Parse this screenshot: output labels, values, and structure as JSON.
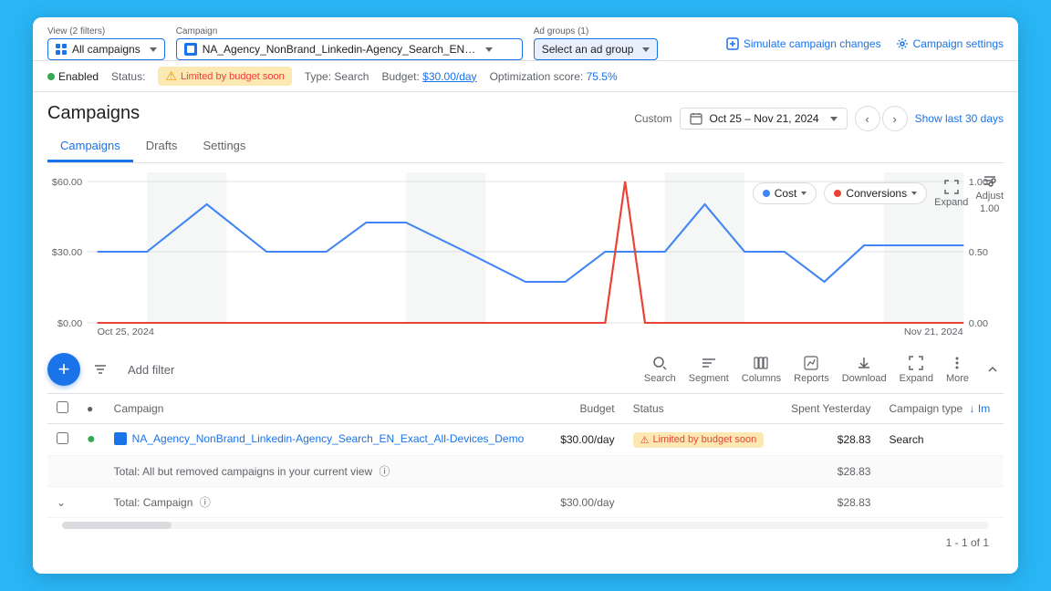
{
  "topbar": {
    "view_label": "View (2 filters)",
    "view_value": "All campaigns",
    "campaign_label": "Campaign",
    "campaign_value": "NA_Agency_NonBrand_Linkedin-Agency_Search_EN_Exact...",
    "campaign_full": "NA_Agency_NonBrand_Linkedin-Agency_Search_EN_Exact_All-Devices_Demo",
    "adgroup_label": "Ad groups (1)",
    "adgroup_value": "Select an ad group",
    "simulate_label": "Simulate campaign changes",
    "settings_label": "Campaign settings"
  },
  "statusbar": {
    "enabled_label": "Enabled",
    "status_label": "Status:",
    "warn_label": "Limited by budget soon",
    "type_label": "Type:",
    "type_value": "Search",
    "budget_label": "Budget:",
    "budget_value": "$30.00/day",
    "opt_label": "Optimization score:",
    "opt_value": "75.5%"
  },
  "header": {
    "title": "Campaigns",
    "custom_label": "Custom",
    "date_range": "Oct 25 – Nov 21, 2024",
    "show_last": "Show last 30 days"
  },
  "tabs": [
    {
      "id": "campaigns",
      "label": "Campaigns",
      "active": true
    },
    {
      "id": "drafts",
      "label": "Drafts",
      "active": false
    },
    {
      "id": "settings",
      "label": "Settings",
      "active": false
    }
  ],
  "chart": {
    "cost_label": "Cost",
    "conversions_label": "Conversions",
    "expand_label": "Expand",
    "adjust_label": "Adjust",
    "adjust_value": "1.00",
    "y_left": [
      "$60.00",
      "$30.00",
      "$0.00"
    ],
    "y_right": [
      "1.00",
      "0.50",
      "0.00"
    ],
    "x_labels": [
      "Oct 25, 2024",
      "Nov 21, 2024"
    ]
  },
  "toolbar": {
    "add_label": "+",
    "filter_label": "Add filter",
    "search_label": "Search",
    "segment_label": "Segment",
    "columns_label": "Columns",
    "reports_label": "Reports",
    "download_label": "Download",
    "expand_label": "Expand",
    "more_label": "More"
  },
  "table": {
    "columns": [
      {
        "id": "campaign",
        "label": "Campaign"
      },
      {
        "id": "budget",
        "label": "Budget",
        "align": "right"
      },
      {
        "id": "status",
        "label": "Status"
      },
      {
        "id": "spent_yesterday",
        "label": "Spent Yesterday",
        "align": "right"
      },
      {
        "id": "campaign_type",
        "label": "Campaign type"
      }
    ],
    "rows": [
      {
        "id": "row1",
        "selected": false,
        "status_color": "#34a853",
        "campaign_name": "NA_Agency_NonBrand_Linkedin-Agency_Search_EN_Exact_All-Devices_Demo",
        "budget": "$30.00/day",
        "status_label": "Limited by budget soon",
        "spent_yesterday": "$28.83",
        "campaign_type": "Search"
      }
    ],
    "total_all": {
      "label": "Total: All but removed campaigns in your current view",
      "budget": "",
      "spent_yesterday": "$28.83"
    },
    "total_campaign": {
      "label": "Total: Campaign",
      "budget": "$30.00/day",
      "spent_yesterday": "$28.83"
    },
    "pagination": "1 - 1 of 1"
  }
}
